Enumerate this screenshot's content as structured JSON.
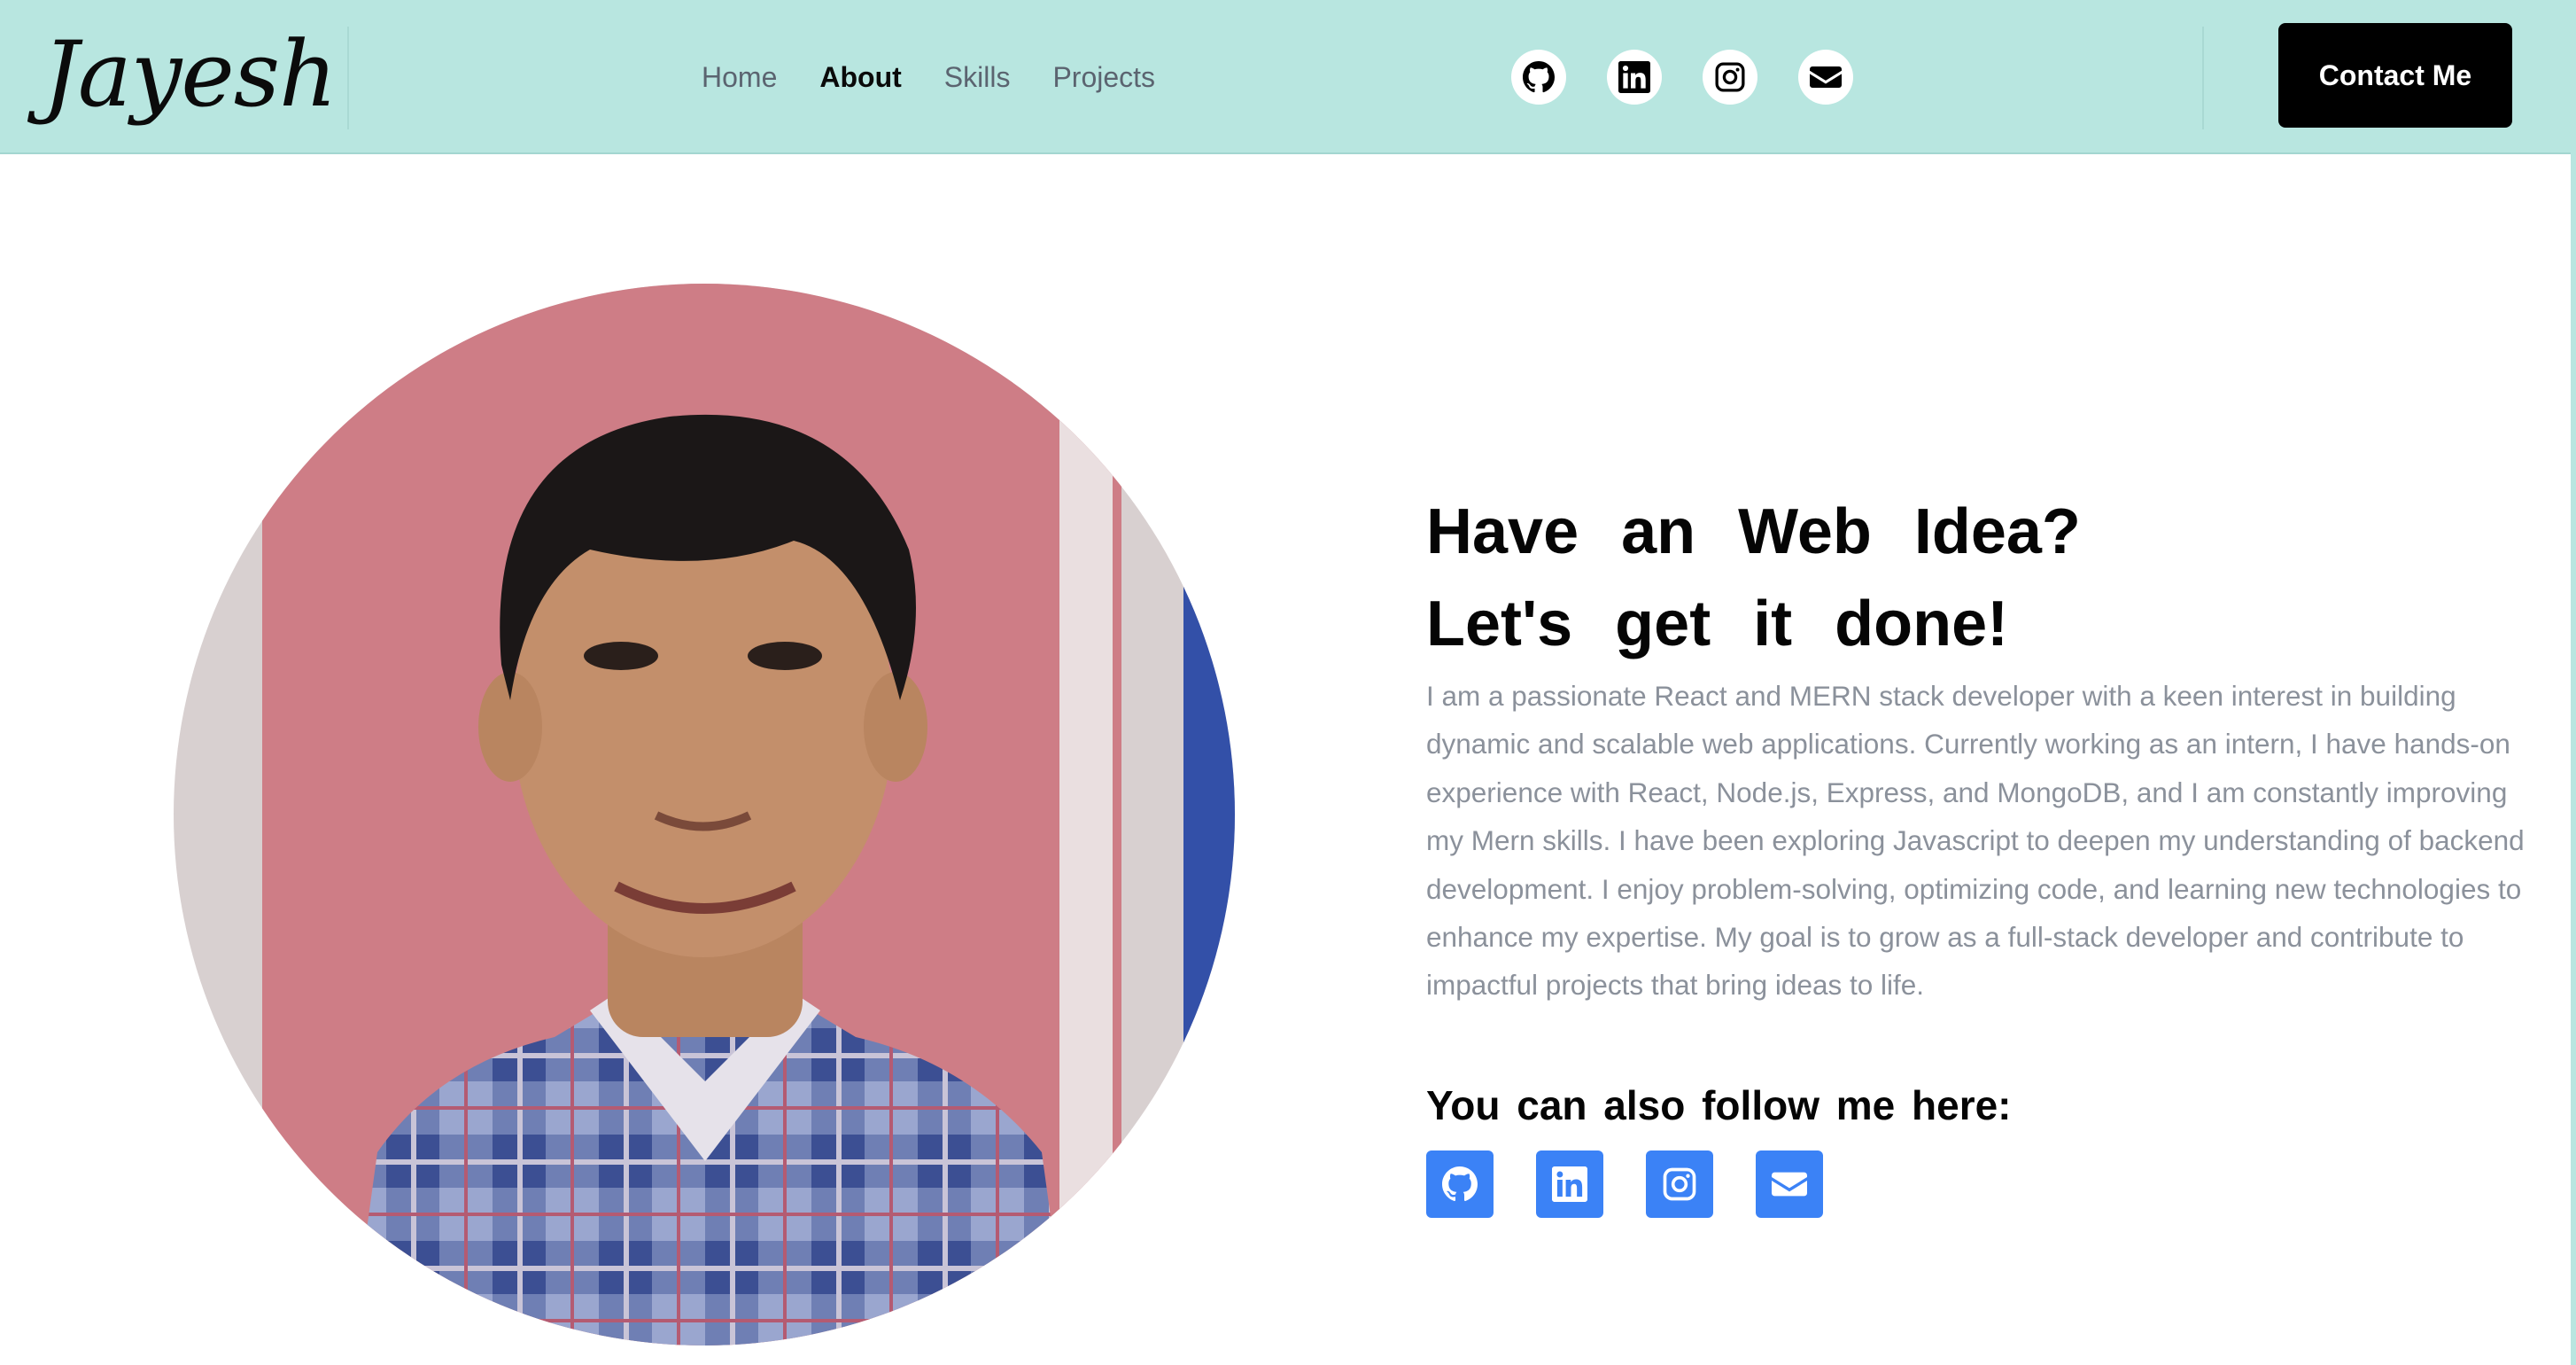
{
  "header": {
    "logo": "Jayesh",
    "nav": [
      {
        "label": "Home",
        "active": false
      },
      {
        "label": "About",
        "active": true
      },
      {
        "label": "Skills",
        "active": false
      },
      {
        "label": "Projects",
        "active": false
      }
    ],
    "social_icons": [
      "github-icon",
      "linkedin-icon",
      "instagram-icon",
      "mail-icon"
    ],
    "contact_label": "Contact Me",
    "background_color": "#b8e6e0"
  },
  "main": {
    "headline_line1": "Have an Web Idea?",
    "headline_line2": "Let's get it done!",
    "bio": "I am a passionate React and MERN stack developer with a keen interest in building dynamic and scalable web applications. Currently working as an intern, I have hands-on experience with React, Node.js, Express, and MongoDB, and I am constantly improving my Mern skills. I have been exploring Javascript to deepen my understanding of backend development. I enjoy problem-solving, optimizing code, and learning new technologies to enhance my expertise. My goal is to grow as a full-stack developer and contribute to impactful projects that bring ideas to life.",
    "follow_title": "You can also follow me here:",
    "follow_icons": [
      "github-icon",
      "linkedin-icon",
      "instagram-icon",
      "mail-icon"
    ],
    "accent_color": "#3b82f6"
  }
}
